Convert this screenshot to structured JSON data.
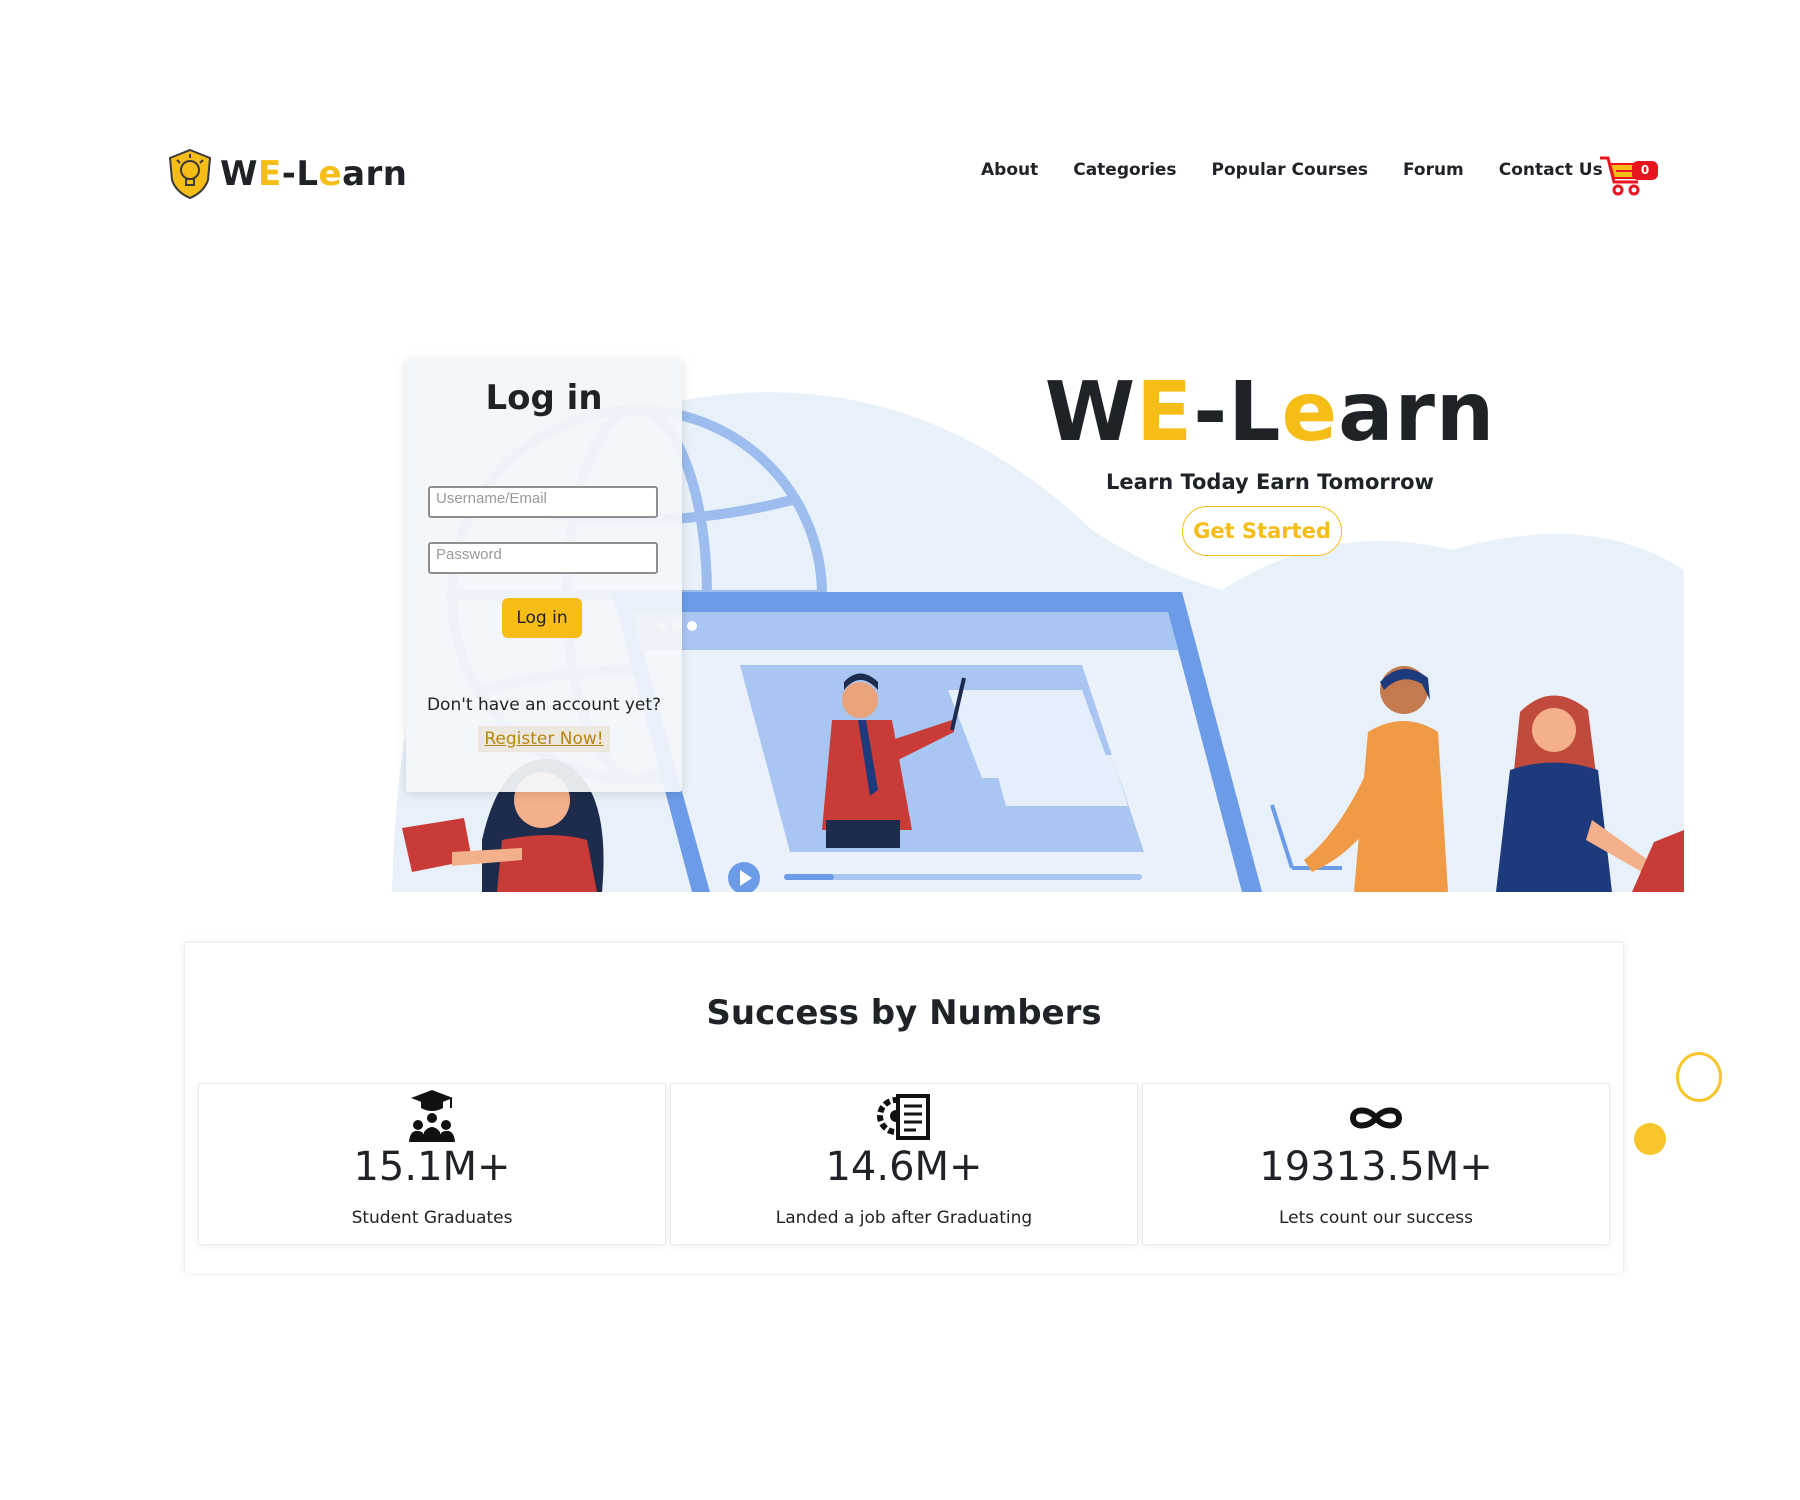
{
  "brand": {
    "part1": "W",
    "part2": "E",
    "part3": "-L",
    "part4": "e",
    "part5": "arn"
  },
  "nav": {
    "items": [
      "About",
      "Categories",
      "Popular Courses",
      "Forum",
      "Contact Us"
    ],
    "cart_count": "0"
  },
  "hero": {
    "title": {
      "p1": "W",
      "p2": "E",
      "p3": "-L",
      "p4": "e",
      "p5": "arn"
    },
    "subtitle": "Learn Today Earn Tomorrow",
    "cta": "Get Started"
  },
  "login": {
    "title": "Log in",
    "username_placeholder": "Username/Email",
    "password_placeholder": "Password",
    "button": "Log in",
    "no_account": "Don't have an account yet?",
    "register": "Register Now!"
  },
  "stats": {
    "title": "Success by Numbers",
    "items": [
      {
        "icon": "graduates-icon",
        "value": "15.1M+",
        "label": "Student Graduates"
      },
      {
        "icon": "job-document-icon",
        "value": "14.6M+",
        "label": "Landed a job after Graduating"
      },
      {
        "icon": "infinity-icon",
        "value": "19313.5M+",
        "label": "Lets count our success"
      }
    ]
  },
  "colors": {
    "accent": "#f6bd16",
    "text": "#1f2328",
    "badge": "#e8141e",
    "illustration_blue": "#6c9be8"
  }
}
